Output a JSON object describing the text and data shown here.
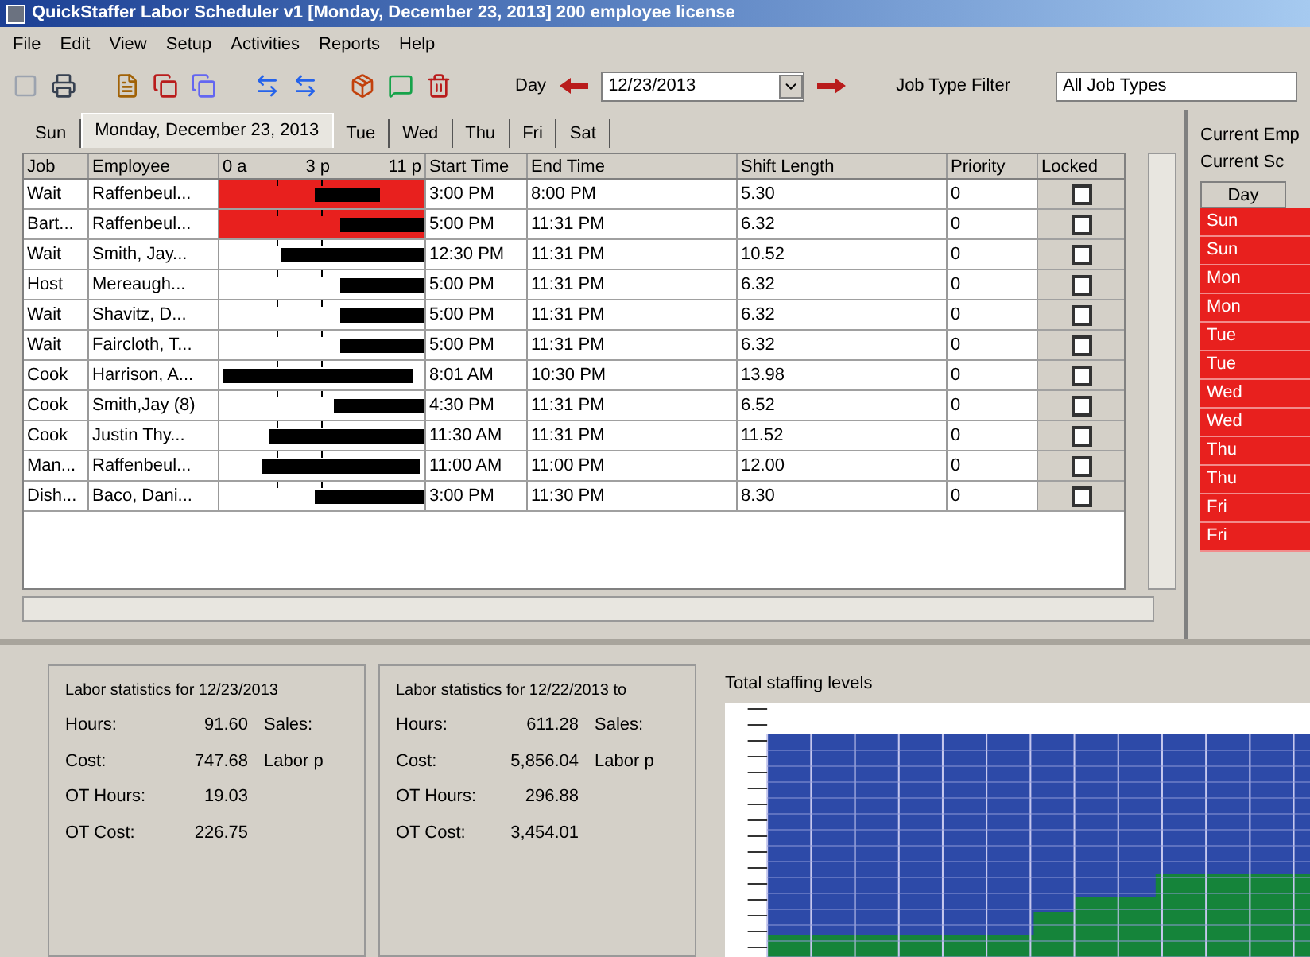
{
  "window": {
    "title": "QuickStaffer Labor Scheduler v1 [Monday, December 23, 2013] 200 employee license"
  },
  "menu": [
    "File",
    "Edit",
    "View",
    "Setup",
    "Activities",
    "Reports",
    "Help"
  ],
  "toolbar": {
    "day_label": "Day",
    "date": "12/23/2013",
    "filter_label": "Job Type Filter",
    "filter_value": "All Job Types"
  },
  "tabs": [
    {
      "label": "Sun",
      "selected": false
    },
    {
      "label": "Monday, December 23, 2013",
      "selected": true
    },
    {
      "label": "Tue",
      "selected": false
    },
    {
      "label": "Wed",
      "selected": false
    },
    {
      "label": "Thu",
      "selected": false
    },
    {
      "label": "Fri",
      "selected": false
    },
    {
      "label": "Sat",
      "selected": false
    }
  ],
  "table": {
    "columns": [
      "Job",
      "Employee",
      "0 a",
      "3 p",
      "11 p",
      "Start Time",
      "End Time",
      "Shift Length",
      "Priority",
      "Locked"
    ],
    "rows": [
      {
        "job": "Wait",
        "employee": "Raffenbeul...",
        "start": "3:00 PM",
        "end": "8:00 PM",
        "length": "5.30",
        "priority": "0",
        "locked": false,
        "conflict": true
      },
      {
        "job": "Bart...",
        "employee": "Raffenbeul...",
        "start": "5:00 PM",
        "end": "11:31 PM",
        "length": "6.32",
        "priority": "0",
        "locked": false,
        "conflict": true
      },
      {
        "job": "Wait",
        "employee": "Smith, Jay...",
        "start": "12:30 PM",
        "end": "11:31 PM",
        "length": "10.52",
        "priority": "0",
        "locked": false,
        "conflict": false
      },
      {
        "job": "Host",
        "employee": "Mereaugh...",
        "start": "5:00 PM",
        "end": "11:31 PM",
        "length": "6.32",
        "priority": "0",
        "locked": false,
        "conflict": false
      },
      {
        "job": "Wait",
        "employee": "Shavitz, D...",
        "start": "5:00 PM",
        "end": "11:31 PM",
        "length": "6.32",
        "priority": "0",
        "locked": false,
        "conflict": false
      },
      {
        "job": "Wait",
        "employee": "Faircloth, T...",
        "start": "5:00 PM",
        "end": "11:31 PM",
        "length": "6.32",
        "priority": "0",
        "locked": false,
        "conflict": false
      },
      {
        "job": "Cook",
        "employee": "Harrison, A...",
        "start": "8:01 AM",
        "end": "10:30 PM",
        "length": "13.98",
        "priority": "0",
        "locked": false,
        "conflict": false
      },
      {
        "job": "Cook",
        "employee": "Smith,Jay (8)",
        "start": "4:30 PM",
        "end": "11:31 PM",
        "length": "6.52",
        "priority": "0",
        "locked": false,
        "conflict": false
      },
      {
        "job": "Cook",
        "employee": "Justin Thy...",
        "start": "11:30 AM",
        "end": "11:31 PM",
        "length": "11.52",
        "priority": "0",
        "locked": false,
        "conflict": false
      },
      {
        "job": "Man...",
        "employee": "Raffenbeul...",
        "start": "11:00 AM",
        "end": "11:00 PM",
        "length": "12.00",
        "priority": "0",
        "locked": false,
        "conflict": false
      },
      {
        "job": "Dish...",
        "employee": "Baco, Dani...",
        "start": "3:00 PM",
        "end": "11:30 PM",
        "length": "8.30",
        "priority": "0",
        "locked": false,
        "conflict": false
      }
    ]
  },
  "side_panel": {
    "title": "Current Emp",
    "subtitle": "Current Sc",
    "column": "Day",
    "rows": [
      {
        "day": "Sun",
        "color": "#e8201e"
      },
      {
        "day": "Sun",
        "color": "#e8201e"
      },
      {
        "day": "Mon",
        "color": "#e8201e"
      },
      {
        "day": "Mon",
        "color": "#e8201e"
      },
      {
        "day": "Tue",
        "color": "#e8201e"
      },
      {
        "day": "Tue",
        "color": "#e8201e"
      },
      {
        "day": "Wed",
        "color": "#e8201e"
      },
      {
        "day": "Wed",
        "color": "#e8201e"
      },
      {
        "day": "Thu",
        "color": "#e8201e"
      },
      {
        "day": "Thu",
        "color": "#e8201e"
      },
      {
        "day": "Fri",
        "color": "#e8201e"
      },
      {
        "day": "Fri",
        "color": "#e8201e"
      }
    ]
  },
  "stats": [
    {
      "title": "Labor statistics for 12/23/2013",
      "rows": [
        {
          "label": "Hours:",
          "value": "91.60",
          "extra": "Sales:"
        },
        {
          "label": "Cost:",
          "value": "747.68",
          "extra": "Labor p"
        },
        {
          "label": "OT Hours:",
          "value": "19.03"
        },
        {
          "label": "OT Cost:",
          "value": "226.75"
        }
      ]
    },
    {
      "title": "Labor statistics for 12/22/2013 to",
      "rows": [
        {
          "label": "Hours:",
          "value": "611.28",
          "extra": "Sales:"
        },
        {
          "label": "Cost:",
          "value": "5,856.04",
          "extra": "Labor p"
        },
        {
          "label": "OT Hours:",
          "value": "296.88"
        },
        {
          "label": "OT Cost:",
          "value": "3,454.01"
        }
      ]
    }
  ],
  "chart": {
    "title": "Total staffing levels"
  }
}
